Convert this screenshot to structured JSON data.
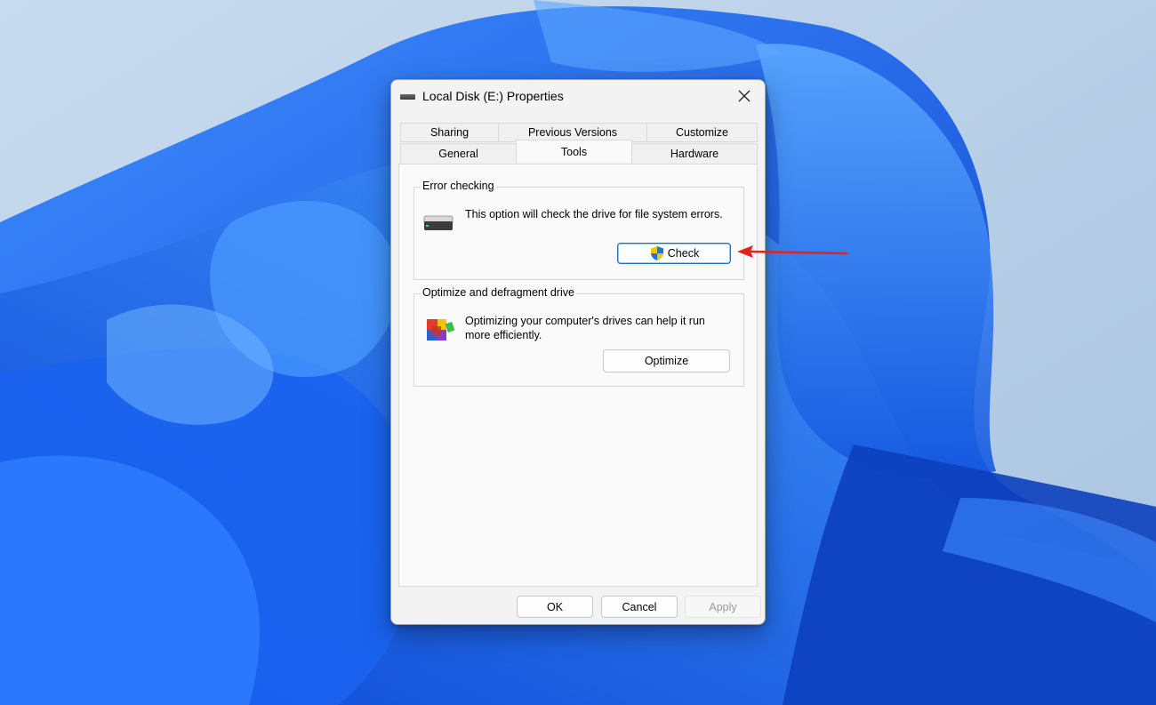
{
  "dialog": {
    "title": "Local Disk (E:) Properties",
    "title_icon": "drive-icon",
    "close_icon": "close-icon"
  },
  "tabs": {
    "row_back": [
      {
        "label": "Sharing"
      },
      {
        "label": "Previous Versions"
      },
      {
        "label": "Customize"
      }
    ],
    "row_front": [
      {
        "label": "General"
      },
      {
        "label": "Tools"
      },
      {
        "label": "Hardware"
      }
    ],
    "active": "Tools"
  },
  "error_checking": {
    "heading": "Error checking",
    "description": "This option will check the drive for file system errors.",
    "button_label": "Check",
    "icon": "hard-drive-icon",
    "button_icon": "uac-shield-icon"
  },
  "optimize": {
    "heading": "Optimize and defragment drive",
    "description": "Optimizing your computer's drives can help it run more efficiently.",
    "button_label": "Optimize",
    "icon": "defrag-icon"
  },
  "footer": {
    "ok_label": "OK",
    "cancel_label": "Cancel",
    "apply_label": "Apply"
  },
  "annotation": {
    "arrow_color": "#e0241b",
    "points_to": "check-button"
  },
  "colors": {
    "wallpaper_bg": "#bcd2e8",
    "bloom_blue": "#1560e8",
    "focus_border": "#1f6fb7"
  }
}
